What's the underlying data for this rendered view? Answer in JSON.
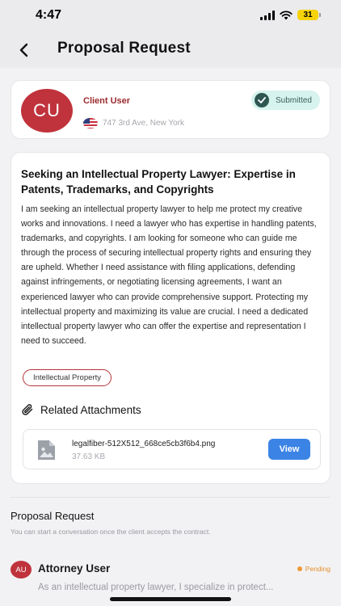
{
  "status_bar": {
    "time": "4:47",
    "battery": "31"
  },
  "nav": {
    "title": "Proposal Request"
  },
  "client": {
    "initials": "CU",
    "name": "Client User",
    "location": "747 3rd Ave, New York",
    "status": "Submitted"
  },
  "proposal": {
    "title": "Seeking an Intellectual Property Lawyer: Expertise in Patents, Trademarks, and Copyrights",
    "body": "I am seeking an intellectual property lawyer to help me protect my creative works and innovations. I need a lawyer who has expertise in handling patents, trademarks, and copyrights. I am looking for someone who can guide me through the process of securing intellectual property rights and ensuring they are upheld. Whether I need assistance with filing applications, defending against infringements, or negotiating licensing agreements, I want an experienced lawyer who can provide comprehensive support. Protecting my intellectual property and maximizing its value are crucial. I need a dedicated intellectual property lawyer who can offer the expertise and representation I need to succeed.",
    "tag": "Intellectual Property"
  },
  "attachments": {
    "title": "Related Attachments",
    "items": [
      {
        "file_name": "legalfiber-512X512_668ce5cb3f6b4.png",
        "size": "37.63 KB",
        "action": "View"
      }
    ]
  },
  "proposal_section": {
    "title": "Proposal Request",
    "subtitle": "You can start a conversation once the client accepts the contract."
  },
  "attorney": {
    "initials": "AU",
    "name": "Attorney User",
    "status": "Pending",
    "message": "As an intellectual property lawyer, I specialize in protect..."
  },
  "colors": {
    "brand": "#c0333c",
    "accent_blue": "#3b84e6",
    "submitted_bg": "#d7f3ee",
    "pending": "#f19a38"
  }
}
